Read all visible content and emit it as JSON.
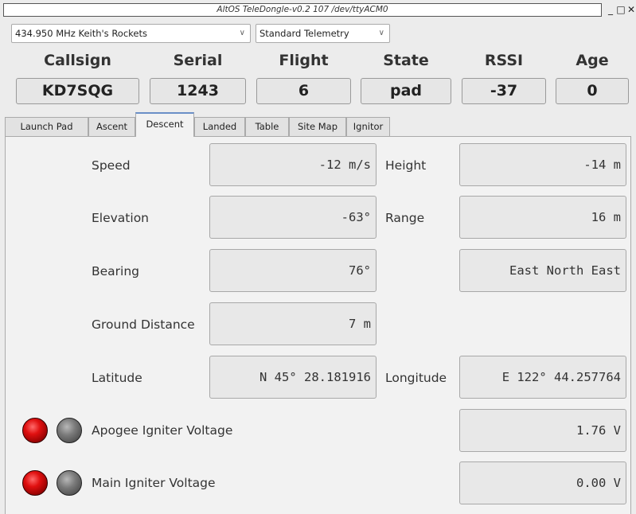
{
  "window": {
    "title": "AltOS TeleDongle-v0.2 107 /dev/ttyACM0",
    "controls": [
      "_",
      "□",
      "✕"
    ]
  },
  "selectors": {
    "frequency": "434.950 MHz Keith's Rockets",
    "telemetry": "Standard Telemetry"
  },
  "status": {
    "headers": [
      "Callsign",
      "Serial",
      "Flight",
      "State",
      "RSSI",
      "Age"
    ],
    "values": [
      "KD7SQG",
      "1243",
      "6",
      "pad",
      "-37",
      "0"
    ]
  },
  "tabs": [
    "Launch Pad",
    "Ascent",
    "Descent",
    "Landed",
    "Table",
    "Site Map",
    "Ignitor"
  ],
  "active_tab": "Descent",
  "descent": {
    "speed_label": "Speed",
    "speed_value": "-12 m/s",
    "height_label": "Height",
    "height_value": "-14 m",
    "elevation_label": "Elevation",
    "elevation_value": "-63°",
    "range_label": "Range",
    "range_value": "16 m",
    "bearing_label": "Bearing",
    "bearing_value": "76°",
    "bearing_direction": "East North East",
    "ground_distance_label": "Ground Distance",
    "ground_distance_value": "7 m",
    "latitude_label": "Latitude",
    "latitude_value": "N 45° 28.181916",
    "longitude_label": "Longitude",
    "longitude_value": "E 122° 44.257764",
    "apogee_label": "Apogee Igniter Voltage",
    "apogee_value": "1.76 V",
    "main_label": "Main Igniter Voltage",
    "main_value": "0.00 V"
  },
  "colors": {
    "led_on": "#e01010",
    "led_off": "#7a7a7a",
    "tab_accent": "#6a8fc7"
  }
}
